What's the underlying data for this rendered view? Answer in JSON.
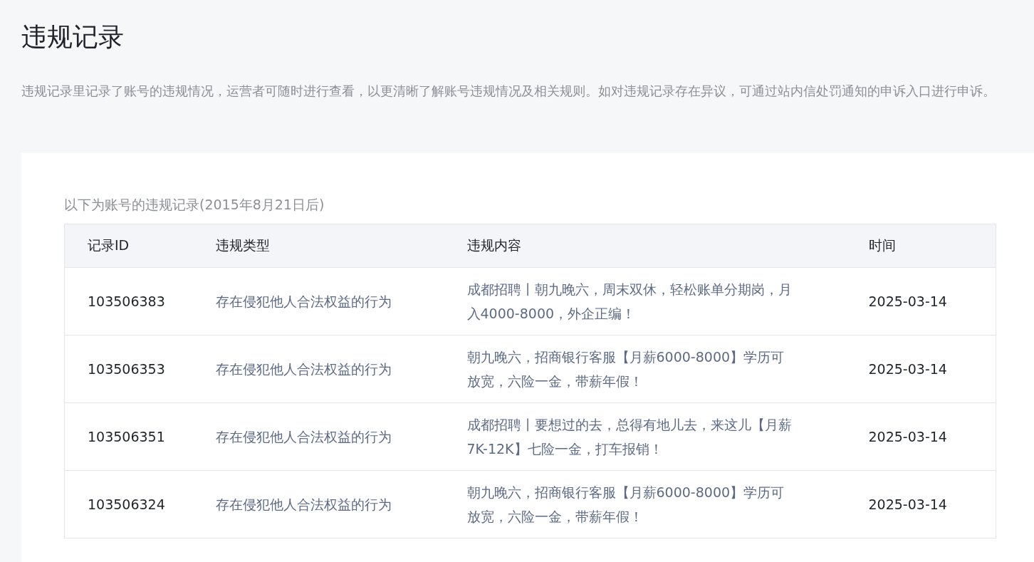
{
  "page": {
    "title": "违规记录",
    "description": "违规记录里记录了账号的违规情况，运营者可随时进行查看，以更清晰了解账号违规情况及相关规则。如对违规记录存在异议，可通过站内信处罚通知的申诉入口进行申诉。"
  },
  "records": {
    "caption": "以下为账号的违规记录(2015年8月21日后)",
    "columns": [
      "记录ID",
      "违规类型",
      "违规内容",
      "时间"
    ],
    "rows": [
      {
        "id": "103506383",
        "type": "存在侵犯他人合法权益的行为",
        "content": "成都招聘丨朝九晚六，周末双休，轻松账单分期岗，月入4000-8000，外企正编！",
        "time": "2025-03-14"
      },
      {
        "id": "103506353",
        "type": "存在侵犯他人合法权益的行为",
        "content": "朝九晚六，招商银行客服【月薪6000-8000】学历可放宽，六险一金，带薪年假！",
        "time": "2025-03-14"
      },
      {
        "id": "103506351",
        "type": "存在侵犯他人合法权益的行为",
        "content": "成都招聘丨要想过的去，总得有地儿去，来这儿【月薪7K-12K】七险一金，打车报销！",
        "time": "2025-03-14"
      },
      {
        "id": "103506324",
        "type": "存在侵犯他人合法权益的行为",
        "content": "朝九晚六，招商银行客服【月薪6000-8000】学历可放宽，六险一金，带薪年假！",
        "time": "2025-03-14"
      }
    ]
  }
}
